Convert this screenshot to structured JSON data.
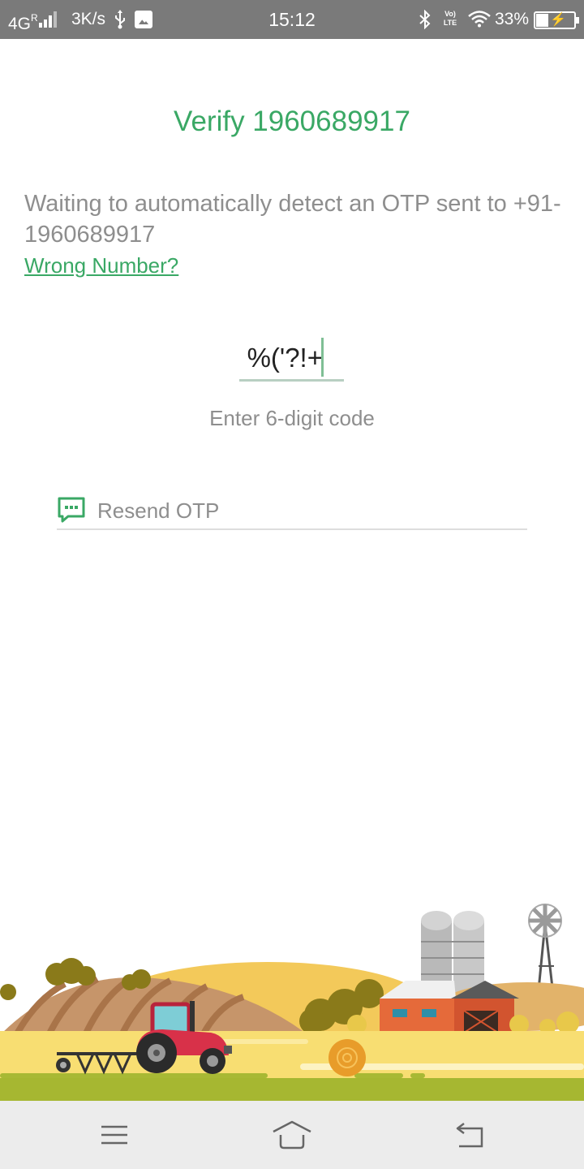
{
  "status_bar": {
    "network": "4G",
    "roaming": "R",
    "speed": "3K/s",
    "time": "15:12",
    "volte": "Vo) LTE",
    "battery_text": "33%",
    "battery_level": 0.33,
    "icons": [
      "signal-icon",
      "usb-icon",
      "image-icon",
      "bluetooth-icon",
      "volte-icon",
      "wifi-icon",
      "battery-icon"
    ]
  },
  "verify": {
    "title": "Verify 1960689917",
    "waiting_text": "Waiting to automatically detect an OTP sent to +91- 1960689917",
    "wrong_number": "Wrong Number?"
  },
  "otp": {
    "value": "%('?!+",
    "hint": "Enter 6-digit code"
  },
  "resend": {
    "label": "Resend OTP",
    "icon": "sms-icon"
  },
  "nav_bar": {
    "icons": [
      "menu-icon",
      "home-icon",
      "back-icon"
    ]
  },
  "colors": {
    "accent": "#3aa865",
    "status_bar": "#7a7a7a",
    "text_secondary": "#8e8e8e"
  }
}
